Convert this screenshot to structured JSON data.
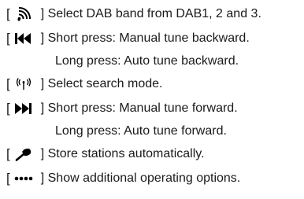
{
  "items": [
    {
      "icon": "dab-band-icon",
      "text": "] Select DAB band from DAB1, 2 and 3."
    },
    {
      "icon": "skip-backward-icon",
      "text": "] Short press: Manual tune backward.",
      "continuation": "Long press: Auto tune backward."
    },
    {
      "icon": "search-mode-antenna-icon",
      "text": "] Select search mode."
    },
    {
      "icon": "skip-forward-icon",
      "text": "] Short press: Manual tune forward.",
      "continuation": "Long press: Auto tune forward."
    },
    {
      "icon": "store-pin-icon",
      "text": "] Store stations automatically."
    },
    {
      "icon": "more-options-dots-icon",
      "text": "] Show additional operating options."
    }
  ],
  "open_bracket": "[",
  "colors": {
    "text": "#1a1a1a",
    "icon": "#000000"
  }
}
